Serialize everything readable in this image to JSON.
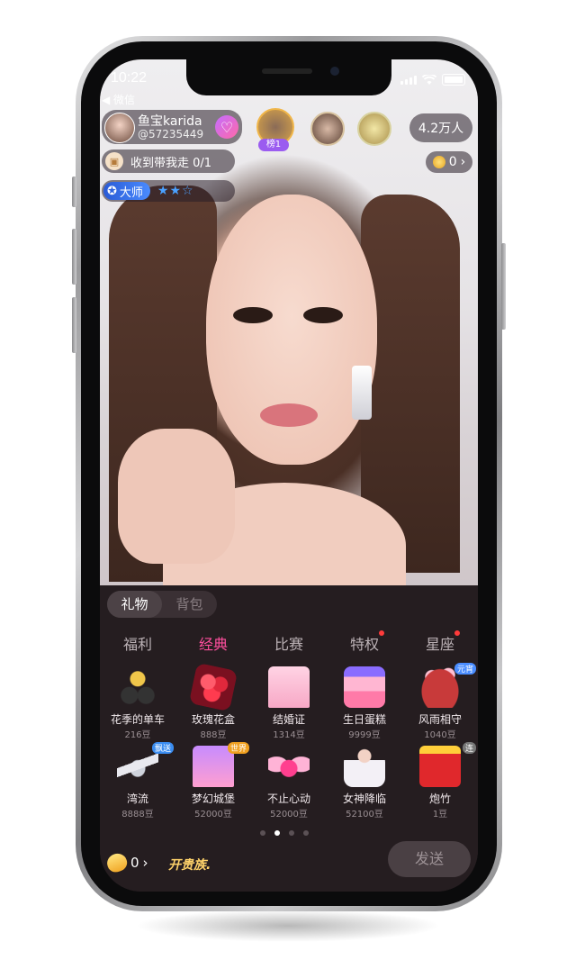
{
  "status": {
    "time": "10:22",
    "back_label": "◀ 微信"
  },
  "host": {
    "name": "鱼宝karida",
    "id": "@57235449"
  },
  "rank_badge": "榜1",
  "viewers": "4.2万人",
  "task": {
    "label": "收到带我走 0/1"
  },
  "coins": {
    "count": "0"
  },
  "master": {
    "label": "大师",
    "stars": "★★☆"
  },
  "panel": {
    "segments": [
      "礼物",
      "背包"
    ],
    "tabs": [
      {
        "label": "福利",
        "dot": false
      },
      {
        "label": "经典",
        "dot": false
      },
      {
        "label": "比赛",
        "dot": false
      },
      {
        "label": "特权",
        "dot": true
      },
      {
        "label": "星座",
        "dot": true
      }
    ],
    "gifts_row1": [
      {
        "name": "花季的单车",
        "price": "216豆",
        "icon": "bicycle-icon"
      },
      {
        "name": "玫瑰花盒",
        "price": "888豆",
        "icon": "rose-box-icon"
      },
      {
        "name": "结婚证",
        "price": "1314豆",
        "icon": "wedding-castle-icon"
      },
      {
        "name": "生日蛋糕",
        "price": "9999豆",
        "icon": "birthday-cake-icon"
      },
      {
        "name": "风雨相守",
        "price": "1040豆",
        "icon": "umbrella-icon",
        "tag": "元宵"
      }
    ],
    "gifts_row2": [
      {
        "name": "湾流",
        "price": "8888豆",
        "icon": "jet-icon",
        "tag": "飘送"
      },
      {
        "name": "梦幻城堡",
        "price": "52000豆",
        "icon": "castle-icon",
        "tag": "世界"
      },
      {
        "name": "不止心动",
        "price": "52000豆",
        "icon": "wing-heart-icon"
      },
      {
        "name": "女神降临",
        "price": "52100豆",
        "icon": "goddess-icon"
      },
      {
        "name": "炮竹",
        "price": "1豆",
        "icon": "firecracker-icon",
        "tag": "连"
      }
    ],
    "bean_count": "0",
    "noble_label": "开贵族.",
    "send_label": "发送"
  },
  "colors": {
    "accent": "#ff4f9e",
    "panel_bg": "#251d20"
  }
}
